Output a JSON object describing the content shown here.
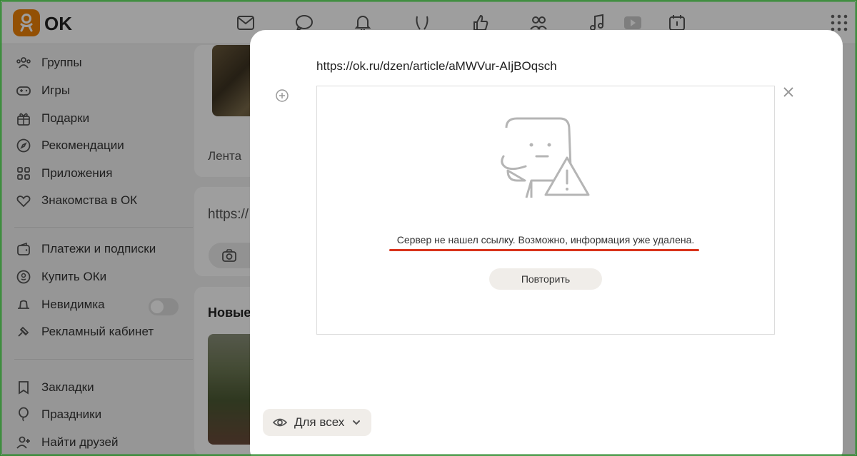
{
  "app": {
    "logo_text": "OK",
    "brand_color": "#ee8208"
  },
  "topbar": {
    "icons": [
      "mail-icon",
      "chat-icon",
      "bell-icon",
      "guests-icon",
      "like-icon",
      "friends-icon",
      "music-icon",
      "video-icon",
      "calendar-icon",
      "apps-grid-icon"
    ]
  },
  "sidebar": {
    "items": [
      {
        "label": "Группы",
        "icon": "groups-icon"
      },
      {
        "label": "Игры",
        "icon": "gamepad-icon"
      },
      {
        "label": "Подарки",
        "icon": "gift-icon"
      },
      {
        "label": "Рекомендации",
        "icon": "compass-icon"
      },
      {
        "label": "Приложения",
        "icon": "apps-icon"
      },
      {
        "label": "Знакомства в ОК",
        "icon": "hearts-icon"
      },
      {
        "label": "Платежи и подписки",
        "icon": "wallet-icon"
      },
      {
        "label": "Купить ОКи",
        "icon": "coin-icon"
      },
      {
        "label": "Невидимка",
        "icon": "hat-icon"
      },
      {
        "label": "Рекламный кабинет",
        "icon": "megaphone-icon"
      },
      {
        "label": "Закладки",
        "icon": "bookmark-icon"
      },
      {
        "label": "Праздники",
        "icon": "balloon-icon"
      },
      {
        "label": "Найти друзей",
        "icon": "add-user-icon"
      }
    ],
    "invisible_toggle_on": false
  },
  "feed": {
    "tab_label": "Лента",
    "url_input_partial": "https://",
    "section_title_partial": "Новые"
  },
  "modal": {
    "url": "https://ok.ru/dzen/article/aMWVur-AIjBOqsch",
    "error_text": "Сервер не нашел ссылку. Возможно, информация уже удалена.",
    "retry_label": "Повторить",
    "privacy_label": "Для всех",
    "underline_color": "#d9331b"
  }
}
